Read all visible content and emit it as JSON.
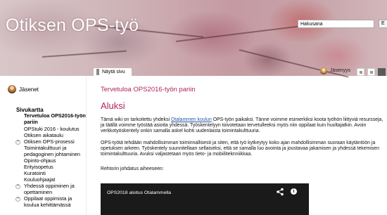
{
  "header": {
    "title": "Otiksen OPS-työ",
    "search_value": "Hakusana",
    "search_button": "E"
  },
  "tabbar": {
    "tab_label": "Näytä sivu",
    "user_label": "Jäsenyys"
  },
  "sidebar": {
    "members_label": "Jäsenet",
    "nav_title": "Sivukartta",
    "items": [
      {
        "label": "Tervetuloa OPS2016-työn pariin",
        "bold": true,
        "bullet": false
      },
      {
        "label": "OPStuki 2016 - koulutus",
        "bold": false,
        "bullet": false
      },
      {
        "label": "Otiksen aikataulu",
        "bold": false,
        "bullet": false
      },
      {
        "label": "Otiksen OPS-prosessi",
        "bold": false,
        "bullet": true
      },
      {
        "label": "Toimintakulttuuri ja pedagoginen johtaminen",
        "bold": false,
        "bullet": false
      },
      {
        "label": "Opinto-ohjaus",
        "bold": false,
        "bullet": false
      },
      {
        "label": "Erityisopetus",
        "bold": false,
        "bullet": false
      },
      {
        "label": "Kuratointi",
        "bold": false,
        "bullet": false
      },
      {
        "label": "Kouluohjaajat",
        "bold": false,
        "bullet": false
      },
      {
        "label": "Yhdessä oppiminen ja opettaminen",
        "bold": false,
        "bullet": true
      },
      {
        "label": "Oppilaat oppimista ja koulua kehittämässä",
        "bold": false,
        "bullet": true
      }
    ]
  },
  "main": {
    "breadcrumb": "Tervetuloa OPS2016-työn pariin",
    "heading": "Aluksi",
    "para1_pre": "Tämä wiki on tarkoitettu yhdeksi ",
    "para1_link": "Otalammen koulun",
    "para1_post": " OPS-työn paikaksi. Tänne voimme esimerkiksi koota työhön liittyviä resursseja, ja täällä voimme työstää asioita yhdessä. Työskentelyyn toivotetaan tervetulleeksi myös niin oppilaat kuin huoltajatkin. Avoin verkkotyöskentely onkin samalla askel kohti uudenlaista toimintakulttuuria.",
    "para2": "OPS-työtä tehdään mahdollisimman toiminnallisesti ja siten, että työ kytkeytyy koko ajan mahdollisimman suoraan käytäntöön ja opetuksen arkeen. Työskentely suunnitellaan sellaiseksi, että se samalla luo avointa ja joustavaa jakamisen ja yhdessä tekemisen toimintakulttuuria. Avuksi valjastetaan myös tieto- ja mobiiliteknniikkaa.",
    "para3": "Rehtorin johdatus aiheeseen:",
    "video_title": "OPS2018 aloitus Otalammella"
  }
}
